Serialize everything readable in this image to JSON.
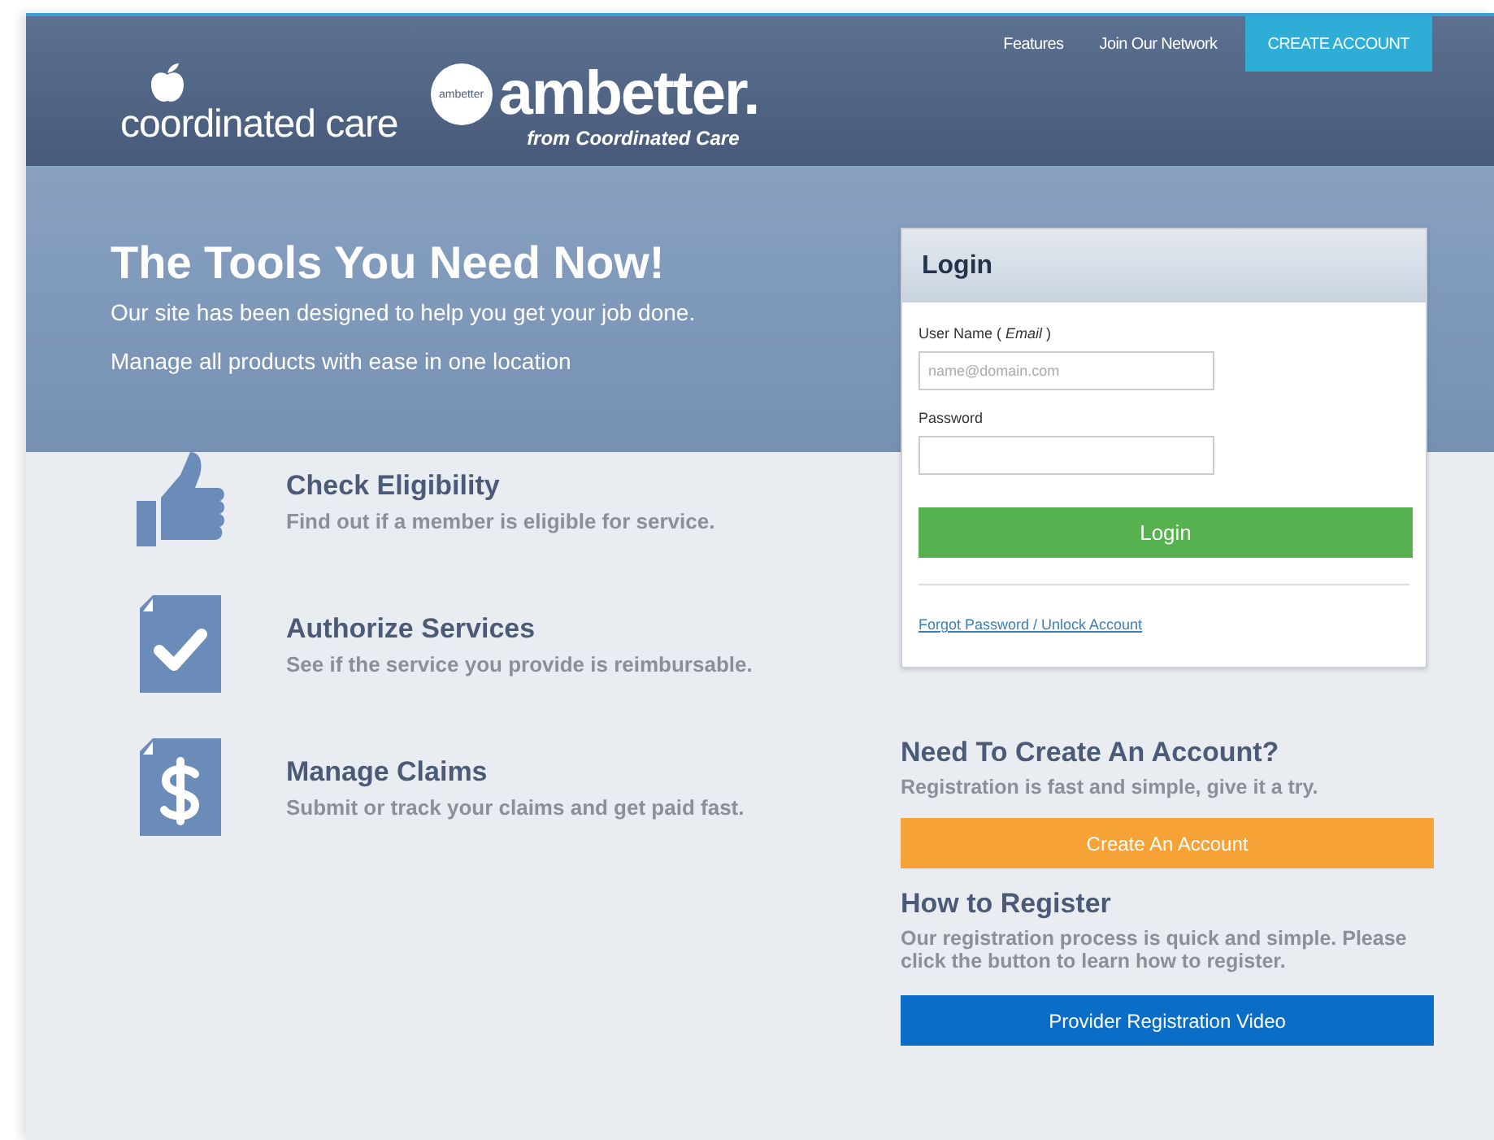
{
  "header": {
    "brand": {
      "name": "coordinated care",
      "badge": "ambetter",
      "product": "ambetter.",
      "tagline": "from Coordinated Care"
    },
    "nav": [
      {
        "label": "Features",
        "kind": "link"
      },
      {
        "label": "Join Our Network",
        "kind": "link"
      },
      {
        "label": "CREATE ACCOUNT",
        "kind": "cta"
      }
    ]
  },
  "hero": {
    "title": "The Tools You Need Now!",
    "lines": [
      "Our site has been designed to help you get your job done.",
      "Manage all products with ease in one location"
    ]
  },
  "features": [
    {
      "kind": "thumb",
      "title": "Check Eligibility",
      "text": "Find out if a member is eligible for service."
    },
    {
      "kind": "check",
      "title": "Authorize Services",
      "text": "See if the service you provide is reimbursable."
    },
    {
      "kind": "dollar",
      "title": "Manage Claims",
      "text": "Submit or track your claims and get paid fast."
    }
  ],
  "login": {
    "title": "Login",
    "username_label": "User Name ( *Email* )",
    "username_placeholder": "name@domain.com",
    "password_label": "Password",
    "button": "Login",
    "forgot_link": "Forgot Password / Unlock Account"
  },
  "create_account": {
    "title": "Need To Create An Account?",
    "text": "Registration is fast and simple, give it a try.",
    "button": "Create An Account"
  },
  "register": {
    "title": "How to Register",
    "text": "Our registration process is quick and simple. Please click the button to learn how to register.",
    "button": "Provider Registration Video"
  }
}
